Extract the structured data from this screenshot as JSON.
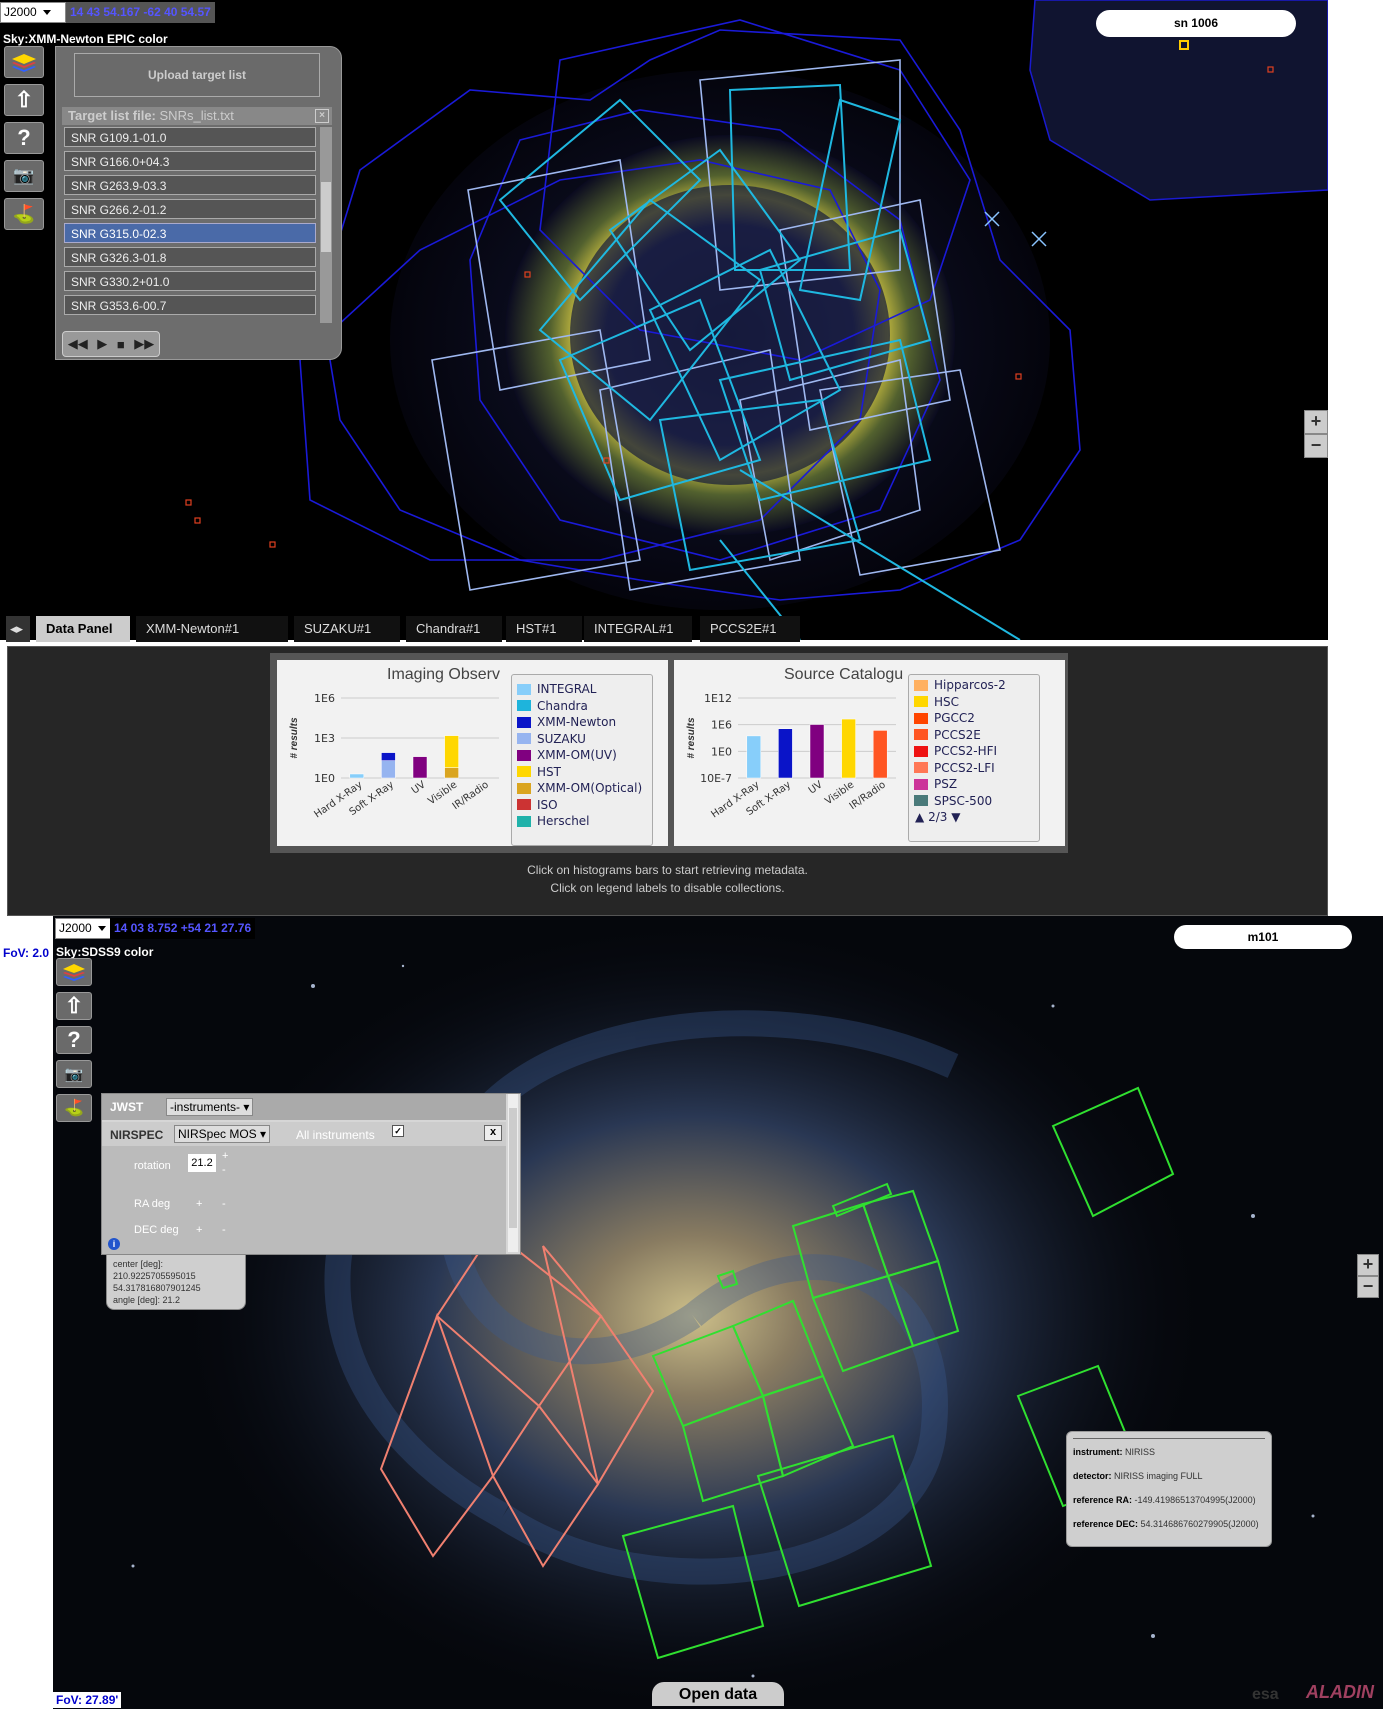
{
  "top": {
    "coord_system": "J2000",
    "coordinates": "14 43 54.167 -62 40 54.57",
    "survey_label": "Sky:XMM-Newton EPIC color",
    "target_name": "sn 1006",
    "upload_button": "Upload target list",
    "target_list_label": "Target list file:",
    "target_list_file": "SNRs_list.txt",
    "targets": [
      "SNR G109.1-01.0",
      "SNR G166.0+04.3",
      "SNR G263.9-03.3",
      "SNR G266.2-01.2",
      "SNR G315.0-02.3",
      "SNR G326.3-01.8",
      "SNR G330.2+01.0",
      "SNR G353.6-00.7"
    ],
    "selected_target_index": 4,
    "zoom_in": "+",
    "zoom_out": "−"
  },
  "tabs": [
    "Data Panel",
    "XMM-Newton#1",
    "SUZAKU#1",
    "Chandra#1",
    "HST#1",
    "INTEGRAL#1",
    "PCCS2E#1"
  ],
  "data_panel": {
    "note_line1": "Click on histograms bars to start retrieving metadata.",
    "note_line2": "Click on legend labels to disable collections.",
    "imaging": {
      "title": "Imaging Observ",
      "ylabel": "# results",
      "yticks": [
        "1E6",
        "1E3",
        "1E0"
      ],
      "categories": [
        "Hard X-Ray",
        "Soft X-Ray",
        "UV",
        "Visible",
        "IR/Radio"
      ],
      "legend": [
        {
          "name": "INTEGRAL",
          "color": "#87cefa"
        },
        {
          "name": "Chandra",
          "color": "#1eb4dc"
        },
        {
          "name": "XMM-Newton",
          "color": "#0a14c8"
        },
        {
          "name": "SUZAKU",
          "color": "#96b4f0"
        },
        {
          "name": "XMM-OM(UV)",
          "color": "#800080"
        },
        {
          "name": "HST",
          "color": "#ffd700"
        },
        {
          "name": "XMM-OM(Optical)",
          "color": "#daa520"
        },
        {
          "name": "ISO",
          "color": "#cc3333"
        },
        {
          "name": "Herschel",
          "color": "#20b2aa"
        }
      ]
    },
    "catalogue": {
      "title": "Source Catalogu",
      "ylabel": "# results",
      "yticks": [
        "1E12",
        "1E6",
        "1E0",
        "10E-7"
      ],
      "categories": [
        "Hard X-Ray",
        "Soft X-Ray",
        "UV",
        "Visible",
        "IR/Radio"
      ],
      "legend": [
        {
          "name": "Hipparcos-2",
          "color": "#ffb060"
        },
        {
          "name": "HSC",
          "color": "#ffd700"
        },
        {
          "name": "PGCC2",
          "color": "#ff4500"
        },
        {
          "name": "PCCS2E",
          "color": "#ff5522"
        },
        {
          "name": "PCCS2-HFI",
          "color": "#ee1111"
        },
        {
          "name": "PCCS2-LFI",
          "color": "#ff7755"
        },
        {
          "name": "PSZ",
          "color": "#cc3399"
        },
        {
          "name": "SPSC-500",
          "color": "#4a7a7a"
        }
      ],
      "pager": "2/3"
    }
  },
  "chart_data": [
    {
      "type": "bar",
      "title": "Imaging Observ",
      "ylabel": "# results",
      "yscale": "log",
      "categories": [
        "Hard X-Ray",
        "Soft X-Ray",
        "UV",
        "Visible",
        "IR/Radio"
      ],
      "series": [
        {
          "name": "INTEGRAL",
          "values": [
            2,
            0,
            0,
            0,
            0
          ]
        },
        {
          "name": "SUZAKU",
          "values": [
            0,
            20,
            0,
            0,
            0
          ]
        },
        {
          "name": "XMM-Newton",
          "values": [
            0,
            60,
            0,
            0,
            0
          ]
        },
        {
          "name": "XMM-OM(UV)",
          "values": [
            0,
            0,
            40,
            0,
            0
          ]
        },
        {
          "name": "XMM-OM(Optical)",
          "values": [
            0,
            0,
            0,
            6,
            0
          ]
        },
        {
          "name": "HST",
          "values": [
            0,
            0,
            0,
            1500,
            0
          ]
        }
      ]
    },
    {
      "type": "bar",
      "title": "Source Catalogu",
      "ylabel": "# results",
      "yscale": "log",
      "categories": [
        "Hard X-Ray",
        "Soft X-Ray",
        "UV",
        "Visible",
        "IR/Radio"
      ],
      "series": [
        {
          "name": "INTEGRAL",
          "values": [
            1000,
            0,
            0,
            0,
            0
          ]
        },
        {
          "name": "XMM-Newton",
          "values": [
            0,
            50000,
            0,
            0,
            0
          ]
        },
        {
          "name": "XMM-OM(UV)",
          "values": [
            0,
            0,
            500000,
            0,
            0
          ]
        },
        {
          "name": "HSC",
          "values": [
            0,
            0,
            0,
            10000000,
            0
          ]
        },
        {
          "name": "PCCS2E",
          "values": [
            0,
            0,
            0,
            0,
            20000
          ]
        }
      ]
    }
  ],
  "bottom": {
    "coord_system": "J2000",
    "coordinates": "14 03 8.752 +54 21 27.76",
    "survey_label": "Sky:SDSS9 color",
    "target_name": "m101",
    "fov_left": "FoV: 2.0",
    "fov_bottom": "FoV: 27.89'",
    "jwst": {
      "label": "JWST",
      "instrument_select": "-instruments-",
      "sub_label": "NIRSPEC",
      "mode_select": "NIRSpec MOS",
      "all_instruments": "All instruments",
      "close": "x",
      "rotation_label": "rotation",
      "rotation_value": "21.2",
      "ra_label": "RA deg",
      "dec_label": "DEC deg",
      "plus": "+",
      "minus": "-"
    },
    "info": {
      "line1": "center [deg]:",
      "line2": "210.9225705595015",
      "line3": "54.317816807901245",
      "line4": "angle [deg]: 21.2"
    },
    "tooltip": {
      "instrument_label": "instrument:",
      "instrument": "NIRISS",
      "detector_label": "detector:",
      "detector": "NIRISS imaging FULL",
      "ra_label": "reference RA:",
      "ra": "-149.41986513704995(J2000)",
      "dec_label": "reference DEC:",
      "dec": "54.314686760279905(J2000)"
    },
    "open_data": "Open data",
    "logo_esa": "esa",
    "logo_aladin": "ALADIN"
  }
}
